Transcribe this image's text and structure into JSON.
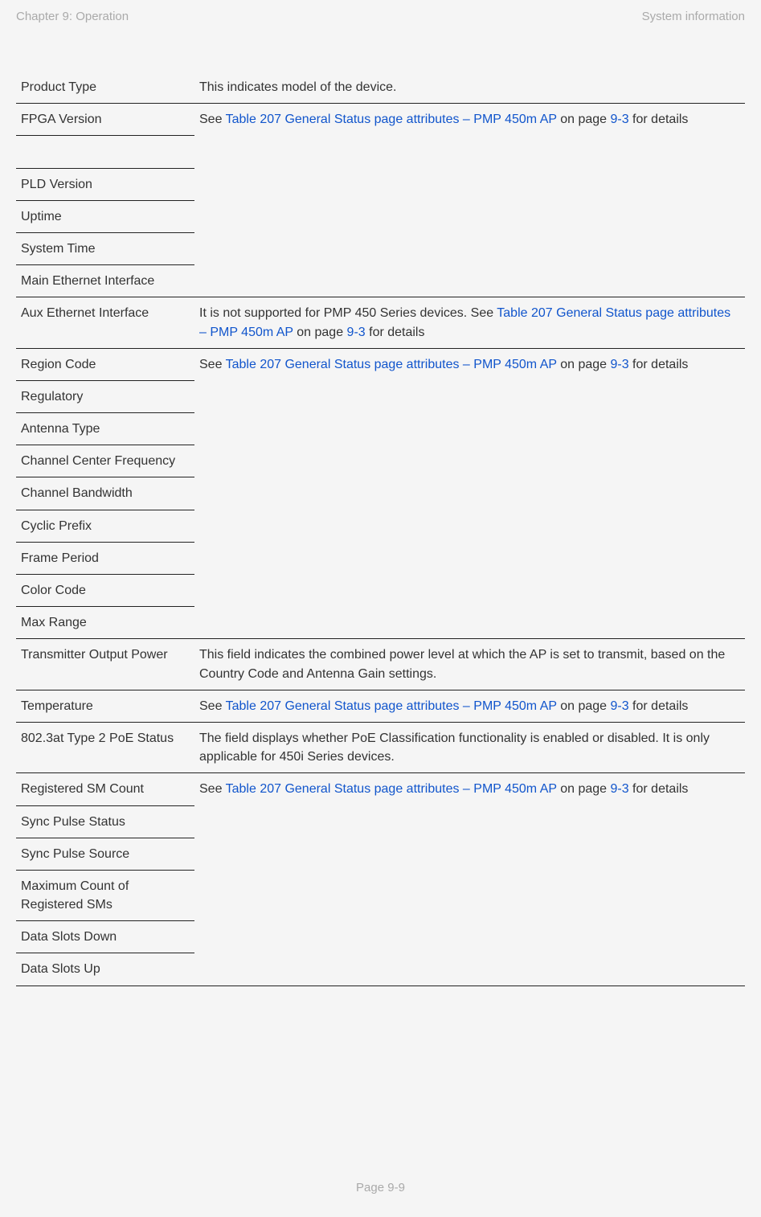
{
  "header": {
    "left": "Chapter 9:  Operation",
    "right": "System information"
  },
  "footer": "Page 9-9",
  "link": {
    "prefix_see": "See ",
    "table_ref": "Table 207 General Status page attributes – PMP 450m AP",
    "on_page": " on page ",
    "page_ref": "9-3",
    "for_details": " for details",
    "aux_prefix": "It is not supported for PMP 450 Series devices. See ",
    "aux_table_ref": "Table 207 General Status page attributes – PMP 450m AP"
  },
  "rows": {
    "product_type": {
      "label": "Product Type",
      "desc": "This indicates model of the device."
    },
    "fpga_version": {
      "label": "FPGA Version"
    },
    "pld_version": {
      "label": "PLD Version"
    },
    "uptime": {
      "label": "Uptime"
    },
    "system_time": {
      "label": "System Time"
    },
    "main_eth": {
      "label": "Main Ethernet Interface"
    },
    "aux_eth": {
      "label": "Aux Ethernet Interface"
    },
    "region_code": {
      "label": "Region Code"
    },
    "regulatory": {
      "label": "Regulatory"
    },
    "antenna_type": {
      "label": "Antenna Type"
    },
    "channel_center": {
      "label": "Channel Center Frequency"
    },
    "channel_bw": {
      "label": "Channel Bandwidth"
    },
    "cyclic_prefix": {
      "label": "Cyclic Prefix"
    },
    "frame_period": {
      "label": "Frame Period"
    },
    "color_code": {
      "label": "Color Code"
    },
    "max_range": {
      "label": "Max Range"
    },
    "tx_power": {
      "label": "Transmitter Output Power",
      "desc": "This field indicates the combined power level at which the AP is set to transmit, based on the Country Code and Antenna Gain settings."
    },
    "temperature": {
      "label": "Temperature"
    },
    "poe_status": {
      "label": "802.3at Type 2 PoE Status",
      "desc": "The field displays whether PoE Classification functionality is enabled or disabled. It is only applicable for 450i Series devices."
    },
    "reg_sm_count": {
      "label": "Registered SM Count"
    },
    "sync_pulse_status": {
      "label": "Sync Pulse Status"
    },
    "sync_pulse_source": {
      "label": "Sync Pulse Source"
    },
    "max_reg_sms": {
      "label": "Maximum Count of Registered SMs"
    },
    "data_slots_down": {
      "label": "Data Slots Down"
    },
    "data_slots_up": {
      "label": "Data Slots Up"
    }
  }
}
